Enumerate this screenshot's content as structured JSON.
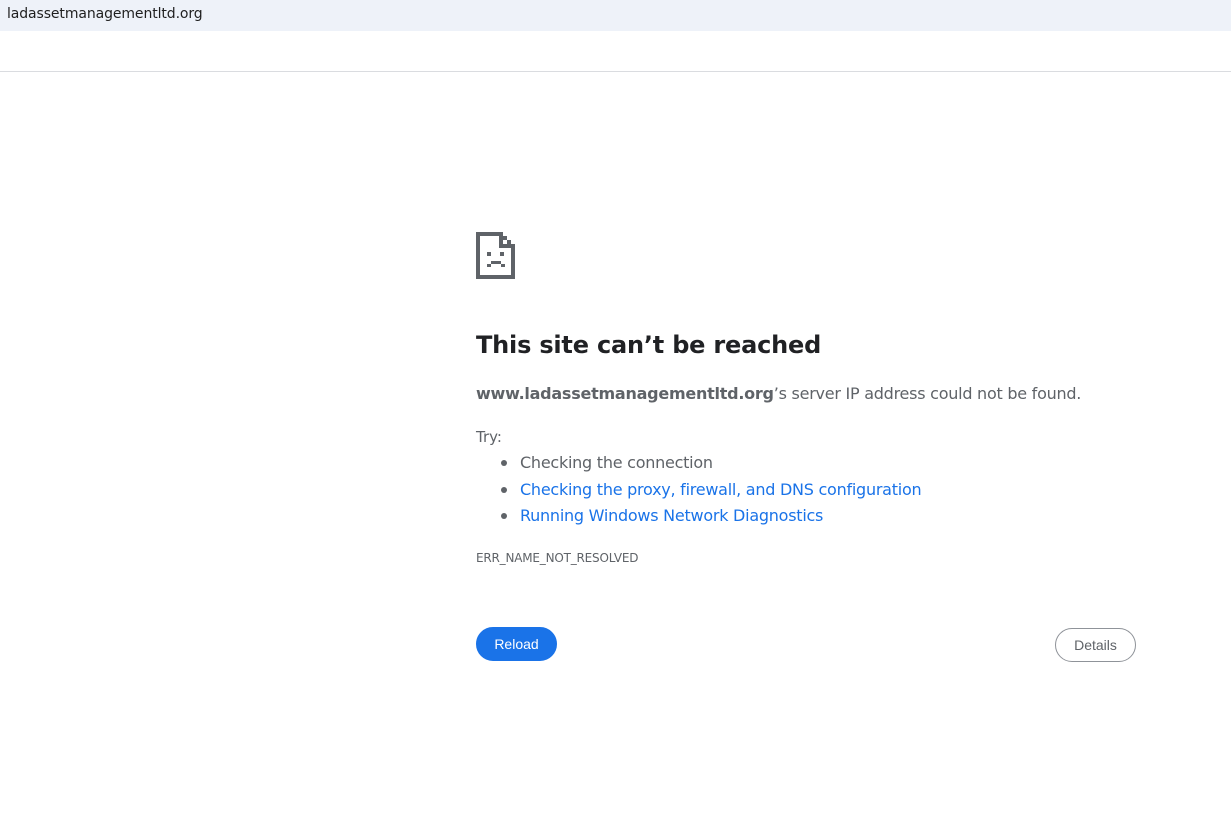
{
  "browser": {
    "address_bar_url": "ladassetmanagementltd.org"
  },
  "error": {
    "icon": "sad-page-icon",
    "title": "This site can’t be reached",
    "summary_domain": "www.ladassetmanagementltd.org",
    "summary_rest": "’s server IP address could not be found.",
    "try_label": "Try:",
    "suggestions": [
      {
        "text": "Checking the connection",
        "is_link": false
      },
      {
        "text": "Checking the proxy, firewall, and DNS configuration",
        "is_link": true
      },
      {
        "text": "Running Windows Network Diagnostics",
        "is_link": true
      }
    ],
    "error_code": "ERR_NAME_NOT_RESOLVED"
  },
  "buttons": {
    "reload_label": "Reload",
    "details_label": "Details"
  },
  "colors": {
    "accent": "#1a73e8",
    "text": "#5f6368",
    "heading": "#202124",
    "address_bar_bg": "#eef2f9"
  }
}
